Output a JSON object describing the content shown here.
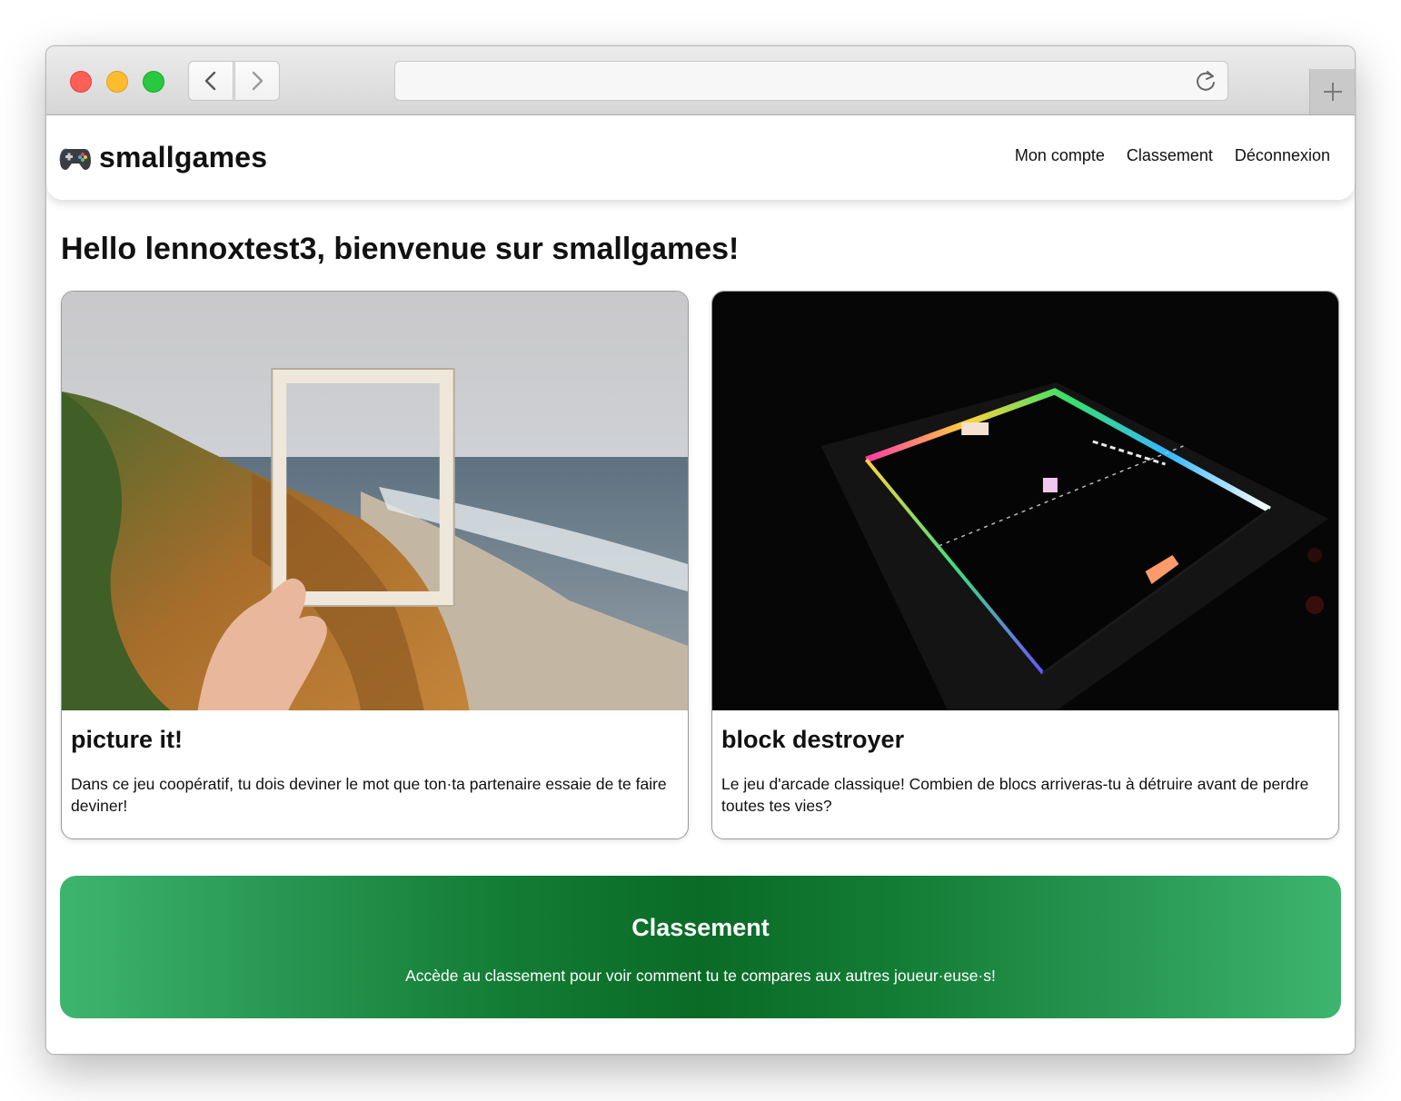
{
  "browser": {
    "url": "",
    "icons": {
      "back": "chevron-left-icon",
      "forward": "chevron-right-icon",
      "reload": "reload-icon",
      "new_tab": "plus-icon"
    },
    "traffic_light_colors": {
      "close": "#fe5f57",
      "minimize": "#febc2e",
      "zoom": "#28c840"
    }
  },
  "header": {
    "logo_icon": "gamepad-icon",
    "brand": "smallgames",
    "nav": [
      "Mon compte",
      "Classement",
      "Déconnexion"
    ]
  },
  "main": {
    "welcome": "Hello lennoxtest3, bienvenue sur smallgames!",
    "games": [
      {
        "title": "picture it!",
        "image": "photo-frame-coast-image",
        "description": "Dans ce jeu coopératif, tu dois deviner le mot que ton·ta partenaire essaie de te faire deviner!"
      },
      {
        "title": "block destroyer",
        "image": "neon-arcade-table-image",
        "description": "Le jeu d'arcade classique! Combien de blocs arriveras-tu à détruire avant de perdre toutes tes vies?"
      }
    ],
    "leaderboard_banner": {
      "title": "Classement",
      "text": "Accède au classement pour voir comment tu te compares aux autres joueur·euse·s!",
      "gradient_colors": [
        "#3db56f",
        "#0a6b26"
      ]
    }
  }
}
